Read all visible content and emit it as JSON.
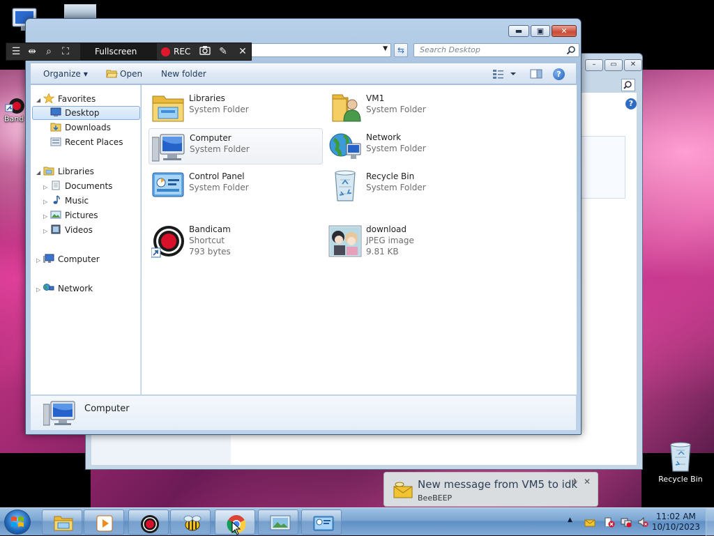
{
  "desktop": {
    "icons": [
      {
        "label": "Bandicam",
        "visible_label": "Band"
      },
      {
        "label": "Recycle Bin"
      }
    ]
  },
  "bandicam_toolbar": {
    "mode_label": "Fullscreen",
    "rec_label": "REC"
  },
  "window": {
    "search_placeholder": "Search Desktop",
    "commands": {
      "organize": "Organize",
      "open": "Open",
      "new_folder": "New folder"
    },
    "nav": {
      "favorites": "Favorites",
      "favorites_items": [
        "Desktop",
        "Downloads",
        "Recent Places"
      ],
      "libraries": "Libraries",
      "libraries_items": [
        "Documents",
        "Music",
        "Pictures",
        "Videos"
      ],
      "computer": "Computer",
      "network": "Network",
      "selected": "Desktop"
    },
    "items": [
      {
        "name": "Libraries",
        "line2": "System Folder",
        "line3": "",
        "icon": "libraries-icon"
      },
      {
        "name": "VM1",
        "line2": "System Folder",
        "line3": "",
        "icon": "user-folder-icon"
      },
      {
        "name": "Computer",
        "line2": "System Folder",
        "line3": "",
        "icon": "computer-icon"
      },
      {
        "name": "Network",
        "line2": "System Folder",
        "line3": "",
        "icon": "network-icon"
      },
      {
        "name": "Control Panel",
        "line2": "System Folder",
        "line3": "",
        "icon": "control-panel-icon"
      },
      {
        "name": "Recycle Bin",
        "line2": "System Folder",
        "line3": "",
        "icon": "recycle-bin-icon"
      },
      {
        "name": "Bandicam",
        "line2": "Shortcut",
        "line3": "793 bytes",
        "icon": "bandicam-icon"
      },
      {
        "name": "download",
        "line2": "JPEG image",
        "line3": "9.81 KB",
        "icon": "jpeg-thumbnail-icon"
      }
    ],
    "hovered_item": "Computer",
    "details_name": "Computer"
  },
  "notification": {
    "title": "New message from VM5 to idk",
    "app": "BeeBEEP"
  },
  "taskbar": {
    "clock_time": "11:02 AM",
    "clock_date": "10/10/2023"
  },
  "colors": {
    "selection": "#cfe3f8",
    "rec_red": "#e0182c",
    "taskbar": "#7aa5d2"
  }
}
